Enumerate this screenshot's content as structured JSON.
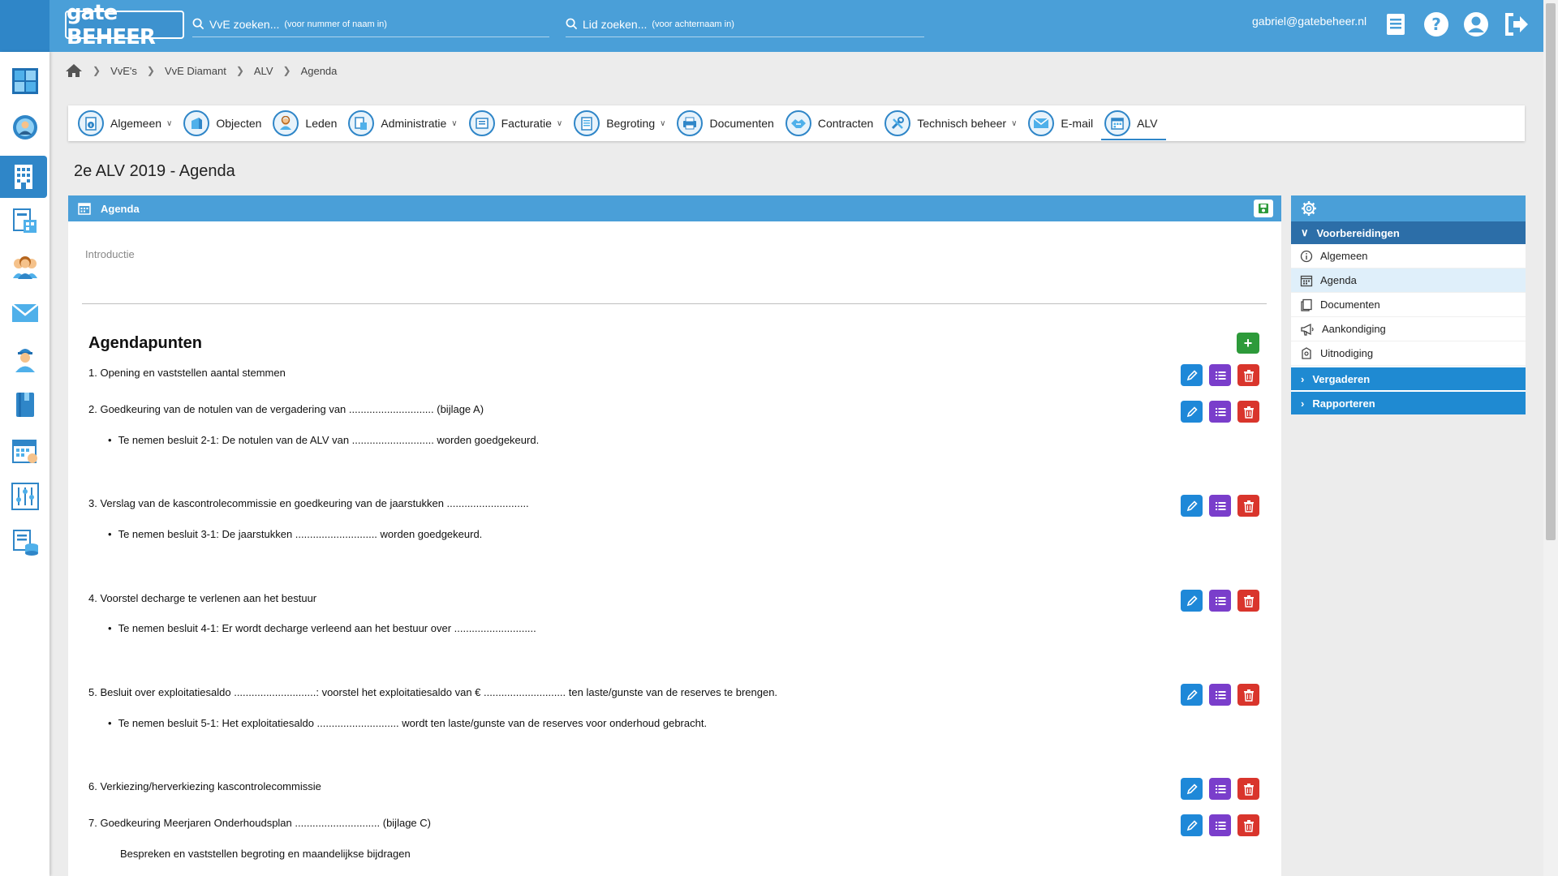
{
  "header": {
    "logo_text": "gate BEHEER",
    "search_vve": {
      "placeholder": "VvE zoeken...",
      "hint": "(voor nummer of naam in)"
    },
    "search_lid": {
      "placeholder": "Lid zoeken...",
      "hint": "(voor achternaam in)"
    },
    "user_email": "gabriel@gatebeheer.nl"
  },
  "breadcrumb": [
    "VvE's",
    "VvE Diamant",
    "ALV",
    "Agenda"
  ],
  "tabs": [
    {
      "label": "Algemeen",
      "dropdown": true
    },
    {
      "label": "Objecten",
      "dropdown": false
    },
    {
      "label": "Leden",
      "dropdown": false
    },
    {
      "label": "Administratie",
      "dropdown": true
    },
    {
      "label": "Facturatie",
      "dropdown": true
    },
    {
      "label": "Begroting",
      "dropdown": true
    },
    {
      "label": "Documenten",
      "dropdown": false
    },
    {
      "label": "Contracten",
      "dropdown": false
    },
    {
      "label": "Technisch beheer",
      "dropdown": true
    },
    {
      "label": "E-mail",
      "dropdown": false
    },
    {
      "label": "ALV",
      "dropdown": false,
      "active": true
    }
  ],
  "page_title": "2e ALV 2019 - Agenda",
  "panel": {
    "header": "Agenda",
    "intro_label": "Introductie",
    "section_title": "Agendapunten",
    "add_label": "+"
  },
  "agenda": [
    {
      "text": "1. Opening en vaststellen aantal stemmen"
    },
    {
      "text": "2. Goedkeuring van de notulen van de vergadering van ............................. (bijlage A)",
      "sub": "Te nemen besluit 2-1: De notulen van de ALV van ............................ worden goedgekeurd."
    },
    {
      "text": "3. Verslag van de kascontrolecommissie en goedkeuring van de jaarstukken ............................",
      "sub": "Te nemen besluit 3-1: De jaarstukken ............................ worden goedgekeurd."
    },
    {
      "text": "4. Voorstel decharge te verlenen aan het bestuur",
      "sub": "Te nemen besluit 4-1: Er wordt decharge verleend aan het bestuur over ............................"
    },
    {
      "text": "5. Besluit over exploitatiesaldo ............................: voorstel het exploitatiesaldo van € ............................ ten laste/gunste van de reserves te brengen.",
      "sub": "Te nemen besluit 5-1: Het exploitatiesaldo ............................ wordt ten laste/gunste van de reserves voor onderhoud gebracht."
    },
    {
      "text": "6. Verkiezing/herverkiezing kascontrolecommissie"
    },
    {
      "text": "7. Goedkeuring Meerjaren Onderhoudsplan ............................. (bijlage C)",
      "note": "Bespreken en vaststellen begroting en maandelijkse bijdragen"
    }
  ],
  "right_panel": {
    "sections": [
      {
        "label": "Voorbereidingen",
        "open": true,
        "items": [
          "Algemeen",
          "Agenda",
          "Documenten",
          "Aankondiging",
          "Uitnodiging"
        ],
        "active_item": "Agenda"
      },
      {
        "label": "Vergaderen",
        "open": false
      },
      {
        "label": "Rapporteren",
        "open": false
      }
    ]
  },
  "colors": {
    "primary": "#4a9fd8",
    "sidebar_active": "#2f86c8",
    "edit": "#1e88d8",
    "list": "#7a3ecb",
    "delete": "#d9352c",
    "add": "#2d9a3a"
  }
}
